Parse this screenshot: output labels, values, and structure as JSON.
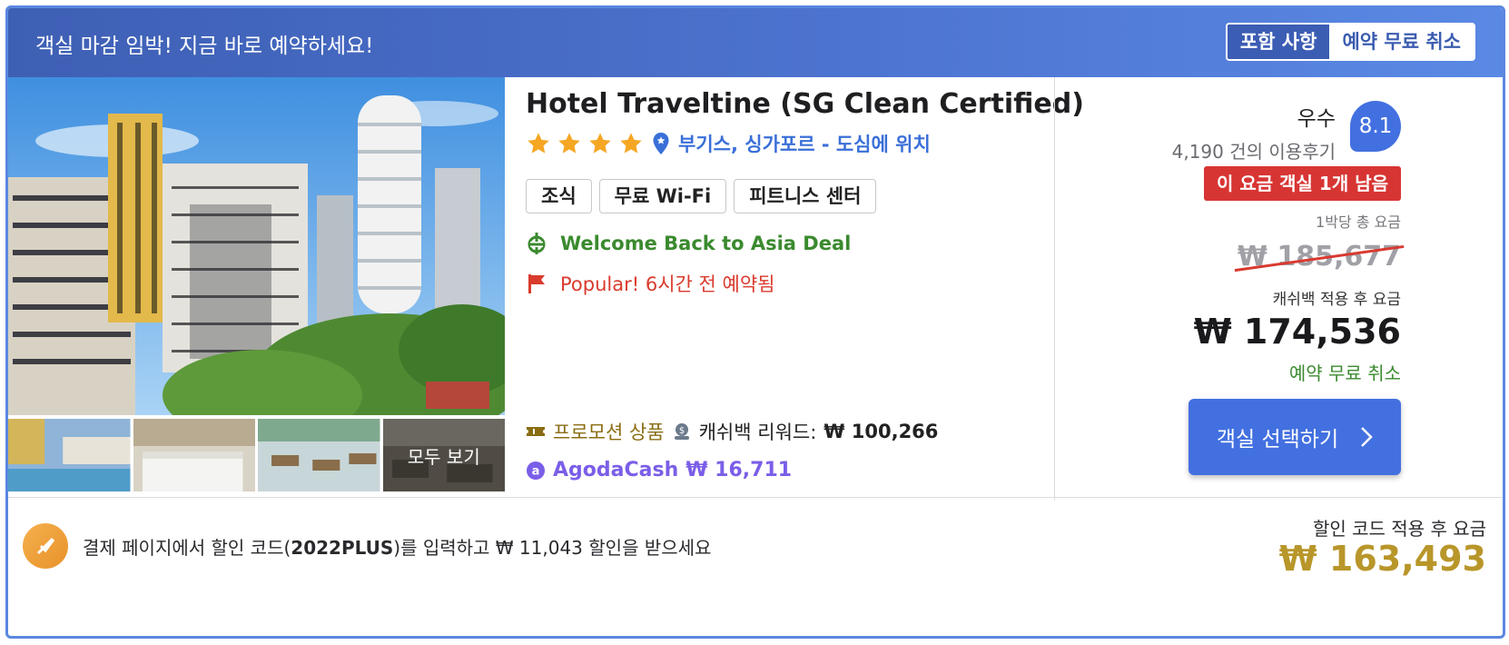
{
  "banner": {
    "text": "객실 마감 임박! 지금 바로 예약하세요!",
    "tag_label": "포함 사항",
    "tag_value": "예약 무료 취소"
  },
  "gallery": {
    "see_all": "모두 보기"
  },
  "hotel": {
    "name": "Hotel Traveltine (SG Clean Certified)",
    "stars": 4,
    "location": "부기스, 싱가포르 - 도심에 위치",
    "amenities": [
      "조식",
      "무료 Wi-Fi",
      "피트니스 센터"
    ],
    "deal": "Welcome Back to Asia Deal",
    "popular": "Popular! 6시간 전 예약됨",
    "promo_label": "프로모션 상품",
    "cashback_label": "캐쉬백 리워드:",
    "cashback_value": "₩ 100,266",
    "agodacash_label": "AgodaCash",
    "agodacash_value": "₩ 16,711"
  },
  "pricing": {
    "rating_label": "우수",
    "rating_score": "8.1",
    "reviews": "4,190 건의 이용후기",
    "rooms_left": "이 요금 객실 1개 남음",
    "per_night": "1박당 총 요금",
    "original_price": "₩ 185,677",
    "after_cashback_label": "캐쉬백 적용 후 요금",
    "final_price": "₩ 174,536",
    "free_cancel": "예약 무료 취소",
    "select_button": "객실 선택하기"
  },
  "coupon": {
    "text_before": "결제 페이지에서 할인 코드(",
    "code": "2022PLUS",
    "text_after": ")를 입력하고 ₩ 11,043 할인을 받으세요",
    "after_code_label": "할인 코드 적용 후 요금",
    "after_code_price": "₩ 163,493"
  },
  "colors": {
    "banner_start": "#3e5fb4",
    "banner_end": "#5a89e4",
    "accent_blue": "#4370e0",
    "deal_green": "#3b8a2f",
    "alert_red": "#d73533",
    "gold": "#b8962a",
    "agoda_purple": "#7b5ee8"
  }
}
